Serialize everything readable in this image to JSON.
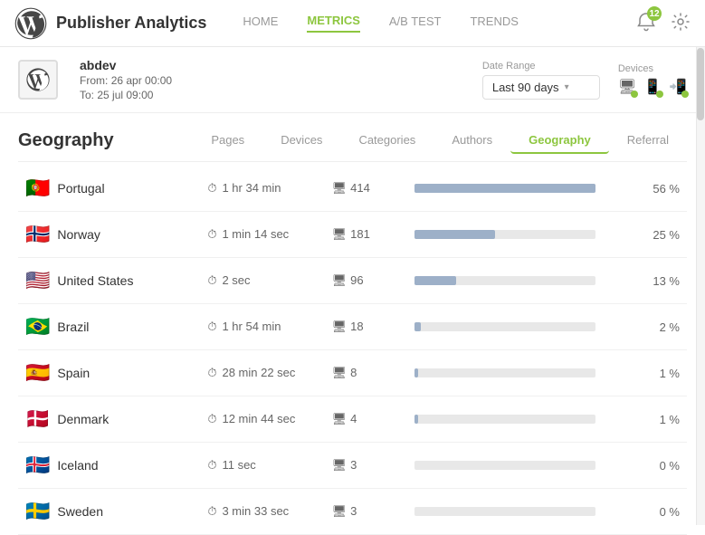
{
  "app": {
    "title": "Publisher Analytics",
    "logo_alt": "WordPress logo"
  },
  "nav": {
    "items": [
      {
        "label": "HOME",
        "active": false
      },
      {
        "label": "METRICS",
        "active": true
      },
      {
        "label": "A/B TEST",
        "active": false
      },
      {
        "label": "TRENDS",
        "active": false
      }
    ]
  },
  "header_actions": {
    "notif_count": "12",
    "gear_label": "Settings"
  },
  "account": {
    "name": "abdev",
    "from_label": "From:",
    "from_date": "26 apr 00:00",
    "to_label": "To:",
    "to_date": "25 jul 09:00"
  },
  "filters": {
    "date_range": {
      "label": "Date Range",
      "value": "Last 90 days"
    },
    "devices": {
      "label": "Devices"
    }
  },
  "tabs": [
    {
      "label": "Pages",
      "active": false
    },
    {
      "label": "Devices",
      "active": false
    },
    {
      "label": "Categories",
      "active": false
    },
    {
      "label": "Authors",
      "active": false
    },
    {
      "label": "Geography",
      "active": true
    },
    {
      "label": "Referral",
      "active": false
    }
  ],
  "section_title": "Geography",
  "table": {
    "rows": [
      {
        "flag": "🇵🇹",
        "country": "Portugal",
        "time": "1 hr 34 min",
        "visits": "414",
        "pct": 56,
        "pct_label": "56 %"
      },
      {
        "flag": "🇳🇴",
        "country": "Norway",
        "time": "1 min 14 sec",
        "visits": "181",
        "pct": 25,
        "pct_label": "25 %"
      },
      {
        "flag": "🇺🇸",
        "country": "United States",
        "time": "2 sec",
        "visits": "96",
        "pct": 13,
        "pct_label": "13 %"
      },
      {
        "flag": "🇧🇷",
        "country": "Brazil",
        "time": "1 hr 54 min",
        "visits": "18",
        "pct": 2,
        "pct_label": "2 %"
      },
      {
        "flag": "🇪🇸",
        "country": "Spain",
        "time": "28 min 22 sec",
        "visits": "8",
        "pct": 1,
        "pct_label": "1 %"
      },
      {
        "flag": "🇩🇰",
        "country": "Denmark",
        "time": "12 min 44 sec",
        "visits": "4",
        "pct": 1,
        "pct_label": "1 %"
      },
      {
        "flag": "🇮🇸",
        "country": "Iceland",
        "time": "11 sec",
        "visits": "3",
        "pct": 0,
        "pct_label": "0 %"
      },
      {
        "flag": "🇸🇪",
        "country": "Sweden",
        "time": "3 min 33 sec",
        "visits": "3",
        "pct": 0,
        "pct_label": "0 %"
      }
    ]
  }
}
